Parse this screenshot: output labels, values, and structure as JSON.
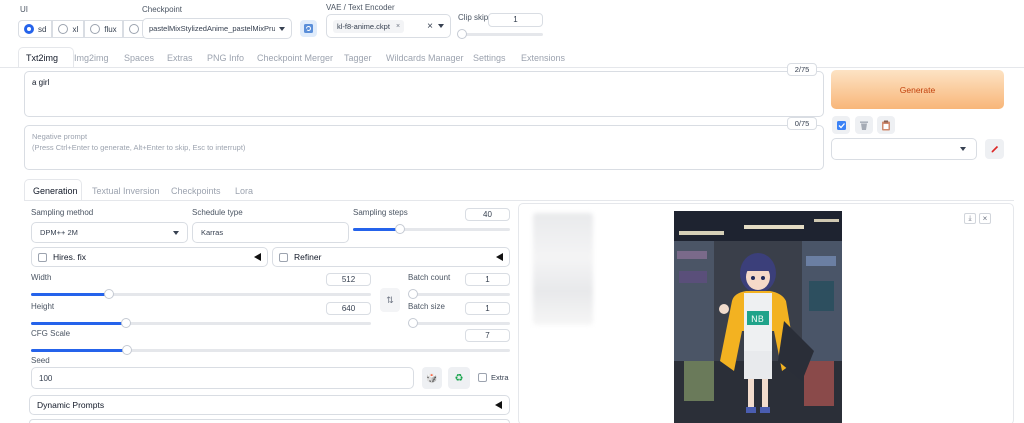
{
  "top": {
    "ui_label": "UI",
    "ui_options": [
      "sd",
      "xl",
      "flux",
      "all"
    ],
    "ui_selected": "sd",
    "checkpoint_label": "Checkpoint",
    "checkpoint_value": "pastelMixStylizedAnime_pastelMixPrune",
    "vae_label": "VAE / Text Encoder",
    "vae_value": "kl-f8-anime.ckpt",
    "clip_skip_label": "Clip skip",
    "clip_skip_value": "1"
  },
  "tabs": [
    "Txt2img",
    "Img2img",
    "Spaces",
    "Extras",
    "PNG Info",
    "Checkpoint Merger",
    "Tagger",
    "Wildcards Manager",
    "Settings",
    "Extensions"
  ],
  "active_tab": "Txt2img",
  "prompt": {
    "value": "a girl",
    "token_count": "2/75",
    "negative_placeholder": "Negative prompt\n(Press Ctrl+Enter to generate, Alt+Enter to skip, Esc to interrupt)",
    "negative_token_count": "0/75"
  },
  "generate_label": "Generate",
  "subtabs": [
    "Generation",
    "Textual Inversion",
    "Checkpoints",
    "Lora"
  ],
  "active_subtab": "Generation",
  "settings": {
    "sampling_method_label": "Sampling method",
    "sampling_method_value": "DPM++ 2M",
    "schedule_type_label": "Schedule type",
    "schedule_type_value": "Karras",
    "sampling_steps_label": "Sampling steps",
    "sampling_steps_value": "40",
    "sampling_steps_fraction": 0.3,
    "hires_label": "Hires. fix",
    "refiner_label": "Refiner",
    "width_label": "Width",
    "width_value": "512",
    "width_fraction": 0.23,
    "height_label": "Height",
    "height_value": "640",
    "height_fraction": 0.28,
    "batch_count_label": "Batch count",
    "batch_count_value": "1",
    "batch_size_label": "Batch size",
    "batch_size_value": "1",
    "cfg_label": "CFG Scale",
    "cfg_value": "7",
    "cfg_fraction": 0.2,
    "seed_label": "Seed",
    "seed_value": "100",
    "extra_label": "Extra",
    "dynamic_prompts_label": "Dynamic Prompts"
  },
  "colors": {
    "accent": "#2563eb",
    "generate_gradient_start": "#fde0c0",
    "generate_gradient_end": "#f8b87a",
    "generate_text": "#c2410c"
  }
}
